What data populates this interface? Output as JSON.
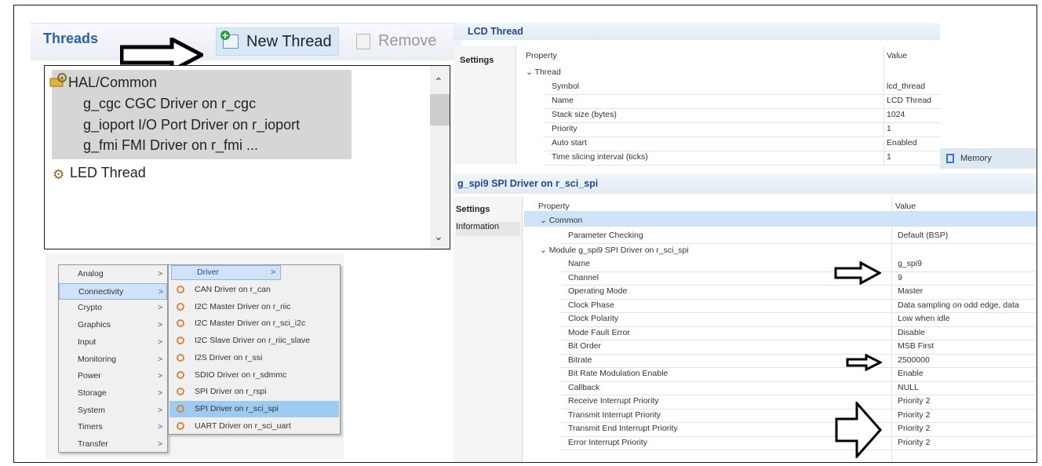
{
  "threads": {
    "title": "Threads",
    "new_thread_label": "New Thread",
    "remove_label": "Remove",
    "items": [
      {
        "label": "HAL/Common",
        "level": 0
      },
      {
        "label": "g_cgc CGC Driver on r_cgc",
        "level": 1
      },
      {
        "label": "g_ioport I/O Port Driver on r_ioport",
        "level": 1
      },
      {
        "label": "g_fmi FMI Driver on r_fmi ...",
        "level": 1
      },
      {
        "label": "LED Thread",
        "level": 0
      }
    ]
  },
  "menu": {
    "categories": [
      "Analog",
      "Connectivity",
      "Crypto",
      "Graphics",
      "Input",
      "Monitoring",
      "Power",
      "Storage",
      "System",
      "Timers",
      "Transfer"
    ],
    "chevron": ">",
    "highlighted_category": "Connectivity",
    "submenu_header": "Driver",
    "submenu_items": [
      "CAN Driver on r_can",
      "I2C Master Driver on r_riic",
      "I2C Master Driver on r_sci_i2c",
      "I2C Slave Driver on r_riic_slave",
      "I2S Driver on r_ssi",
      "SDIO Driver on r_sdmmc",
      "SPI Driver on r_rspi",
      "SPI Driver on r_sci_spi",
      "UART Driver on r_sci_uart"
    ],
    "highlighted_item": "SPI Driver on r_sci_spi"
  },
  "lcd_panel": {
    "title": "LCD Thread",
    "tab_settings": "Settings",
    "col_property": "Property",
    "col_value": "Value",
    "group": "Thread",
    "rows": [
      {
        "property": "Symbol",
        "value": "lcd_thread"
      },
      {
        "property": "Name",
        "value": "LCD Thread"
      },
      {
        "property": "Stack size (bytes)",
        "value": "1024"
      },
      {
        "property": "Priority",
        "value": "1"
      },
      {
        "property": "Auto start",
        "value": "Enabled"
      },
      {
        "property": "Time slicing interval (ticks)",
        "value": "1"
      }
    ],
    "memory_tab": "Memory"
  },
  "spi_panel": {
    "title": "g_spi9 SPI Driver on r_sci_spi",
    "tab_settings": "Settings",
    "tab_information": "Information",
    "col_property": "Property",
    "col_value": "Value",
    "group_common": "Common",
    "common_rows": [
      {
        "property": "Parameter Checking",
        "value": "Default (BSP)"
      }
    ],
    "group_module": "Module g_spi9 SPI Driver on r_sci_spi",
    "module_rows": [
      {
        "property": "Name",
        "value": "g_spi9"
      },
      {
        "property": "Channel",
        "value": "9"
      },
      {
        "property": "Operating Mode",
        "value": "Master"
      },
      {
        "property": "Clock Phase",
        "value": "Data sampling on odd edge, data"
      },
      {
        "property": "Clock Polarity",
        "value": "Low when idle"
      },
      {
        "property": "Mode Fault Error",
        "value": "Disable"
      },
      {
        "property": "Bit Order",
        "value": "MSB First"
      },
      {
        "property": "Bitrate",
        "value": "2500000"
      },
      {
        "property": "Bit Rate Modulation Enable",
        "value": "Enable"
      },
      {
        "property": "Callback",
        "value": "NULL"
      },
      {
        "property": "Receive Interrupt Priority",
        "value": "Priority 2"
      },
      {
        "property": "Transmit Interrupt Priority",
        "value": "Priority 2"
      },
      {
        "property": "Transmit End Interrupt Priority",
        "value": "Priority 2"
      },
      {
        "property": "Error Interrupt Priority",
        "value": "Priority 2"
      }
    ]
  },
  "colors": {
    "title_blue": "#2e5fa7",
    "selection_blue": "#9ecbf2",
    "header_highlight": "#cfe2f7"
  }
}
